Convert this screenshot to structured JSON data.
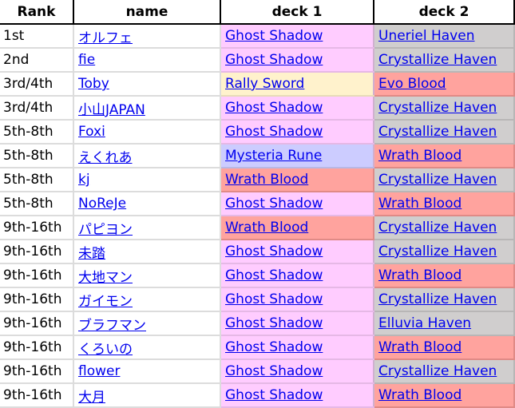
{
  "colors": {
    "Ghost Shadow": "#ffccff",
    "Rally Sword": "#fff2cc",
    "Mysteria Rune": "#ccccff",
    "Wrath Blood": "#ffa39e",
    "Evo Blood": "#ffa39e",
    "Uneriel Haven": "#d0cece",
    "Crystallize Haven": "#d0cece",
    "Elluvia Haven": "#d0cece",
    "link": "#0000ee"
  },
  "headers": {
    "rank": "Rank",
    "name": "name",
    "deck1": "deck 1",
    "deck2": "deck 2"
  },
  "rows": [
    {
      "rank": "1st",
      "name": "オルフェ",
      "deck1": "Ghost Shadow",
      "deck2": "Uneriel Haven"
    },
    {
      "rank": "2nd",
      "name": "fie",
      "deck1": "Ghost Shadow",
      "deck2": "Crystallize Haven"
    },
    {
      "rank": "3rd/4th",
      "name": "Toby",
      "deck1": "Rally Sword",
      "deck2": "Evo Blood"
    },
    {
      "rank": "3rd/4th",
      "name": "小山JAPAN",
      "deck1": "Ghost Shadow",
      "deck2": "Crystallize Haven"
    },
    {
      "rank": "5th-8th",
      "name": "Foxi",
      "deck1": "Ghost Shadow",
      "deck2": "Crystallize Haven"
    },
    {
      "rank": "5th-8th",
      "name": "えくれあ",
      "deck1": "Mysteria Rune",
      "deck2": "Wrath Blood"
    },
    {
      "rank": "5th-8th",
      "name": "kj",
      "deck1": "Wrath Blood",
      "deck2": "Crystallize Haven"
    },
    {
      "rank": "5th-8th",
      "name": "NoReJe",
      "deck1": "Ghost Shadow",
      "deck2": "Wrath Blood"
    },
    {
      "rank": "9th-16th",
      "name": "パピヨン",
      "deck1": "Wrath Blood",
      "deck2": "Crystallize Haven"
    },
    {
      "rank": "9th-16th",
      "name": "未踏",
      "deck1": "Ghost Shadow",
      "deck2": "Crystallize Haven"
    },
    {
      "rank": "9th-16th",
      "name": "大地マン",
      "deck1": "Ghost Shadow",
      "deck2": "Wrath Blood"
    },
    {
      "rank": "9th-16th",
      "name": "ガイモン",
      "deck1": "Ghost Shadow",
      "deck2": "Crystallize Haven"
    },
    {
      "rank": "9th-16th",
      "name": "ブラフマン",
      "deck1": "Ghost Shadow",
      "deck2": "Elluvia Haven"
    },
    {
      "rank": "9th-16th",
      "name": "くろいの",
      "deck1": "Ghost Shadow",
      "deck2": "Wrath Blood"
    },
    {
      "rank": "9th-16th",
      "name": "flower",
      "deck1": "Ghost Shadow",
      "deck2": "Crystallize Haven"
    },
    {
      "rank": "9th-16th",
      "name": "大月",
      "deck1": "Ghost Shadow",
      "deck2": "Wrath Blood"
    }
  ]
}
